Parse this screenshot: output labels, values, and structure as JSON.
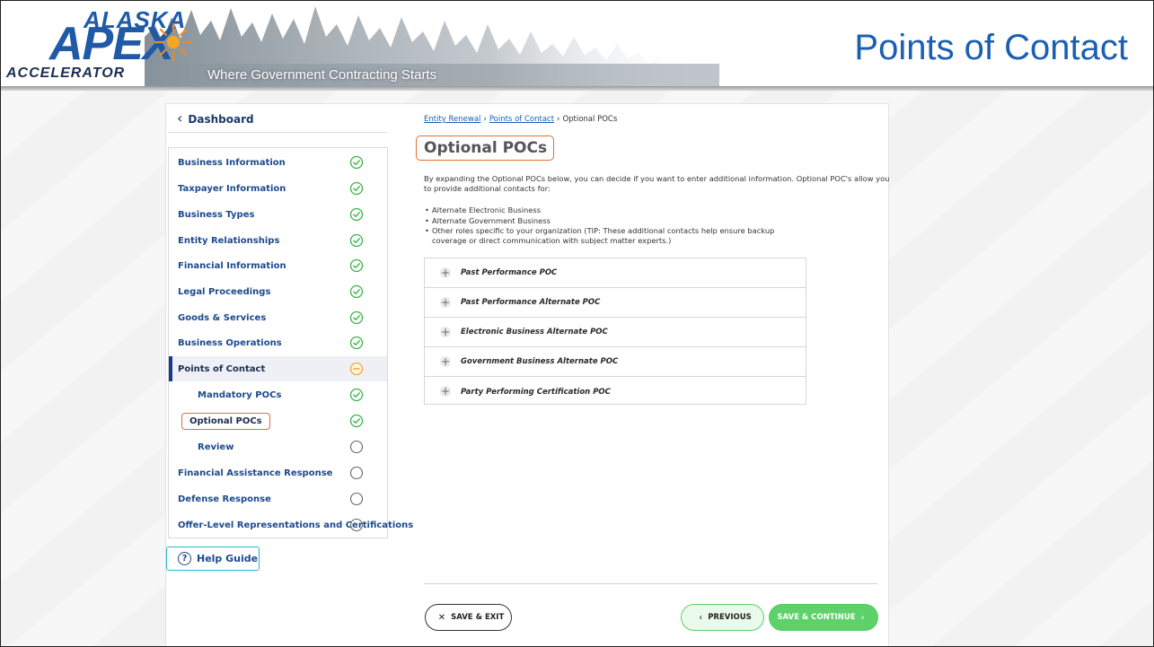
{
  "header": {
    "logo_alaska": "ALASKA",
    "logo_apex": "APEX",
    "logo_accelerator": "ACCELERATOR",
    "tagline": "Where Government Contracting Starts",
    "title": "Points of Contact"
  },
  "sidebar": {
    "dashboard_label": "Dashboard",
    "items": [
      {
        "label": "Business Information",
        "status": "complete"
      },
      {
        "label": "Taxpayer Information",
        "status": "complete"
      },
      {
        "label": "Business Types",
        "status": "complete"
      },
      {
        "label": "Entity Relationships",
        "status": "complete"
      },
      {
        "label": "Financial Information",
        "status": "complete"
      },
      {
        "label": "Legal Proceedings",
        "status": "complete"
      },
      {
        "label": "Goods & Services",
        "status": "complete"
      },
      {
        "label": "Business Operations",
        "status": "complete"
      },
      {
        "label": "Points of Contact",
        "status": "in-progress"
      },
      {
        "label": "Mandatory POCs",
        "status": "complete"
      },
      {
        "label": "Optional POCs",
        "status": "complete"
      },
      {
        "label": "Review",
        "status": "not-started"
      },
      {
        "label": "Financial Assistance Response",
        "status": "not-started"
      },
      {
        "label": "Defense Response",
        "status": "not-started"
      },
      {
        "label": "Offer-Level Representations and Certifications",
        "status": "not-started"
      }
    ],
    "help_label": "Help Guide"
  },
  "main": {
    "breadcrumb": {
      "link1": "Entity Renewal",
      "link2": "Points of Contact",
      "current": "Optional POCs",
      "separator": "›"
    },
    "heading": "Optional POCs",
    "description": "By expanding the Optional POCs below, you can decide if you want to enter additional information. Optional POC's allow you to provide additional contacts for:",
    "bullets": [
      "Alternate Electronic Business",
      "Alternate Government Business",
      "Other roles specific to your organization (TIP: These additional contacts help ensure backup coverage or direct communication with subject matter experts.)"
    ],
    "accordion": [
      "Past Performance POC",
      "Past Performance Alternate POC",
      "Electronic Business Alternate POC",
      "Government Business Alternate POC",
      "Party Performing Certification POC"
    ]
  },
  "footer": {
    "save_exit": "SAVE & EXIT",
    "previous": "PREVIOUS",
    "save_continue": "SAVE & CONTINUE"
  },
  "colors": {
    "brand_blue": "#1a5fb4",
    "nav_blue": "#1c4a8d",
    "complete_green": "#3ab54a",
    "in_progress_orange": "#f0a830",
    "highlight_orange": "#e56f2e",
    "continue_green": "#5fd16a"
  },
  "icons": {
    "dashboard": "chevron-left-icon",
    "complete": "check-circle-icon",
    "in_progress": "minus-circle-icon",
    "not_started": "empty-circle-icon",
    "accordion": "plus-circle-icon",
    "help": "question-circle-icon"
  }
}
